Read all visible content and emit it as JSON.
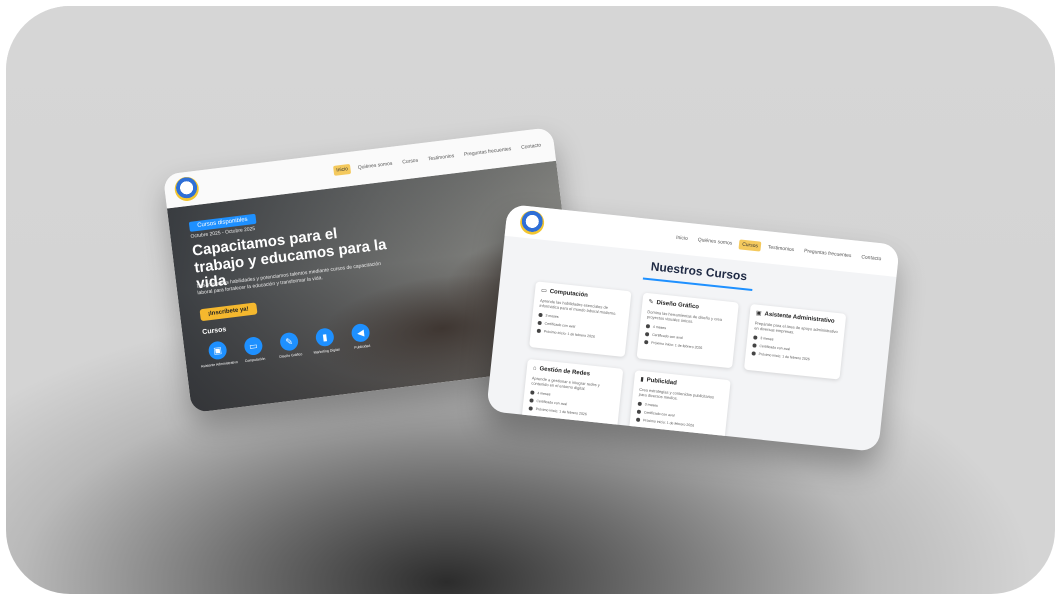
{
  "landing": {
    "nav": [
      {
        "label": "Inicio",
        "active": true
      },
      {
        "label": "Quiénes somos",
        "active": false
      },
      {
        "label": "Cursos",
        "active": false
      },
      {
        "label": "Testimonios",
        "active": false
      },
      {
        "label": "Preguntas frecuentes",
        "active": false
      },
      {
        "label": "Contacto",
        "active": false
      }
    ],
    "hero": {
      "badge": "Cursos disponibles",
      "dates": "Octubre 2025 - Octubre 2025",
      "title": "Capacitamos para el trabajo y educamos para la vida",
      "description": "Desarrollamos habilidades y potenciamos talentos mediante cursos de capacitación laboral para fortalecer la educación y transformar la vida.",
      "cta": "¡Inscríbete ya!"
    },
    "courses_label": "Cursos",
    "course_icons": [
      {
        "icon": "briefcase-icon",
        "glyph": "▣",
        "label": "Asistente Administrativo"
      },
      {
        "icon": "laptop-icon",
        "glyph": "▭",
        "label": "Computación"
      },
      {
        "icon": "brush-icon",
        "glyph": "✎",
        "label": "Diseño Gráfico"
      },
      {
        "icon": "chart-icon",
        "glyph": "▮",
        "label": "Marketing Digital"
      },
      {
        "icon": "megaphone-icon",
        "glyph": "◀",
        "label": "Publicidad"
      }
    ]
  },
  "courses_page": {
    "nav": [
      {
        "label": "Inicio",
        "active": false
      },
      {
        "label": "Quiénes somos",
        "active": false
      },
      {
        "label": "Cursos",
        "active": true
      },
      {
        "label": "Testimonios",
        "active": false
      },
      {
        "label": "Preguntas frecuentes",
        "active": false
      },
      {
        "label": "Contacto",
        "active": false
      }
    ],
    "title": "Nuestros Cursos",
    "cards": [
      {
        "title": "Computación",
        "icon": "monitor-icon",
        "glyph": "▭",
        "desc": "Aprende las habilidades esenciales de informática para el mundo laboral moderno.",
        "meta": [
          "3 meses",
          "Certificado con aval",
          "Próximo inicio: 1 de febrero 2026"
        ]
      },
      {
        "title": "Diseño Gráfico",
        "icon": "brush-icon",
        "glyph": "✎",
        "desc": "Domina las herramientas de diseño y crea proyectos visuales únicos.",
        "meta": [
          "4 meses",
          "Certificado con aval",
          "Próximo inicio: 1 de febrero 2026"
        ]
      },
      {
        "title": "Asistente Administrativo",
        "icon": "briefcase-icon",
        "glyph": "▣",
        "desc": "Prepárate para el área de apoyo administrativo en diversas empresas.",
        "meta": [
          "3 meses",
          "Certificado con aval",
          "Próximo inicio: 1 de febrero 2026"
        ]
      },
      {
        "title": "Gestión de Redes",
        "icon": "network-icon",
        "glyph": "⌂",
        "desc": "Aprende a gestionar e integrar redes y contenido en el entorno digital.",
        "meta": [
          "4 meses",
          "Certificado con aval",
          "Próximo inicio: 1 de febrero 2026"
        ]
      },
      {
        "title": "Publicidad",
        "icon": "chart-icon",
        "glyph": "▮",
        "desc": "Crea estrategias y contenidos publicitarios para diversos medios.",
        "meta": [
          "3 meses",
          "Certificado con aval",
          "Próximo inicio: 1 de febrero 2026"
        ]
      }
    ]
  }
}
